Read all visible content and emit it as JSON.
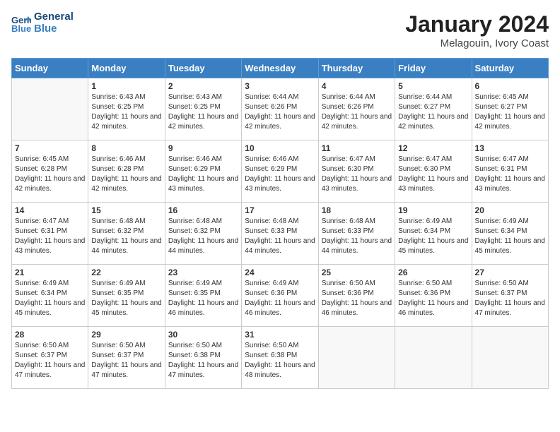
{
  "header": {
    "logo_line1": "General",
    "logo_line2": "Blue",
    "title": "January 2024",
    "subtitle": "Melagouin, Ivory Coast"
  },
  "columns": [
    "Sunday",
    "Monday",
    "Tuesday",
    "Wednesday",
    "Thursday",
    "Friday",
    "Saturday"
  ],
  "weeks": [
    [
      {
        "num": "",
        "sunrise": "",
        "sunset": "",
        "daylight": ""
      },
      {
        "num": "1",
        "sunrise": "Sunrise: 6:43 AM",
        "sunset": "Sunset: 6:25 PM",
        "daylight": "Daylight: 11 hours and 42 minutes."
      },
      {
        "num": "2",
        "sunrise": "Sunrise: 6:43 AM",
        "sunset": "Sunset: 6:25 PM",
        "daylight": "Daylight: 11 hours and 42 minutes."
      },
      {
        "num": "3",
        "sunrise": "Sunrise: 6:44 AM",
        "sunset": "Sunset: 6:26 PM",
        "daylight": "Daylight: 11 hours and 42 minutes."
      },
      {
        "num": "4",
        "sunrise": "Sunrise: 6:44 AM",
        "sunset": "Sunset: 6:26 PM",
        "daylight": "Daylight: 11 hours and 42 minutes."
      },
      {
        "num": "5",
        "sunrise": "Sunrise: 6:44 AM",
        "sunset": "Sunset: 6:27 PM",
        "daylight": "Daylight: 11 hours and 42 minutes."
      },
      {
        "num": "6",
        "sunrise": "Sunrise: 6:45 AM",
        "sunset": "Sunset: 6:27 PM",
        "daylight": "Daylight: 11 hours and 42 minutes."
      }
    ],
    [
      {
        "num": "7",
        "sunrise": "Sunrise: 6:45 AM",
        "sunset": "Sunset: 6:28 PM",
        "daylight": "Daylight: 11 hours and 42 minutes."
      },
      {
        "num": "8",
        "sunrise": "Sunrise: 6:46 AM",
        "sunset": "Sunset: 6:28 PM",
        "daylight": "Daylight: 11 hours and 42 minutes."
      },
      {
        "num": "9",
        "sunrise": "Sunrise: 6:46 AM",
        "sunset": "Sunset: 6:29 PM",
        "daylight": "Daylight: 11 hours and 43 minutes."
      },
      {
        "num": "10",
        "sunrise": "Sunrise: 6:46 AM",
        "sunset": "Sunset: 6:29 PM",
        "daylight": "Daylight: 11 hours and 43 minutes."
      },
      {
        "num": "11",
        "sunrise": "Sunrise: 6:47 AM",
        "sunset": "Sunset: 6:30 PM",
        "daylight": "Daylight: 11 hours and 43 minutes."
      },
      {
        "num": "12",
        "sunrise": "Sunrise: 6:47 AM",
        "sunset": "Sunset: 6:30 PM",
        "daylight": "Daylight: 11 hours and 43 minutes."
      },
      {
        "num": "13",
        "sunrise": "Sunrise: 6:47 AM",
        "sunset": "Sunset: 6:31 PM",
        "daylight": "Daylight: 11 hours and 43 minutes."
      }
    ],
    [
      {
        "num": "14",
        "sunrise": "Sunrise: 6:47 AM",
        "sunset": "Sunset: 6:31 PM",
        "daylight": "Daylight: 11 hours and 43 minutes."
      },
      {
        "num": "15",
        "sunrise": "Sunrise: 6:48 AM",
        "sunset": "Sunset: 6:32 PM",
        "daylight": "Daylight: 11 hours and 44 minutes."
      },
      {
        "num": "16",
        "sunrise": "Sunrise: 6:48 AM",
        "sunset": "Sunset: 6:32 PM",
        "daylight": "Daylight: 11 hours and 44 minutes."
      },
      {
        "num": "17",
        "sunrise": "Sunrise: 6:48 AM",
        "sunset": "Sunset: 6:33 PM",
        "daylight": "Daylight: 11 hours and 44 minutes."
      },
      {
        "num": "18",
        "sunrise": "Sunrise: 6:48 AM",
        "sunset": "Sunset: 6:33 PM",
        "daylight": "Daylight: 11 hours and 44 minutes."
      },
      {
        "num": "19",
        "sunrise": "Sunrise: 6:49 AM",
        "sunset": "Sunset: 6:34 PM",
        "daylight": "Daylight: 11 hours and 45 minutes."
      },
      {
        "num": "20",
        "sunrise": "Sunrise: 6:49 AM",
        "sunset": "Sunset: 6:34 PM",
        "daylight": "Daylight: 11 hours and 45 minutes."
      }
    ],
    [
      {
        "num": "21",
        "sunrise": "Sunrise: 6:49 AM",
        "sunset": "Sunset: 6:34 PM",
        "daylight": "Daylight: 11 hours and 45 minutes."
      },
      {
        "num": "22",
        "sunrise": "Sunrise: 6:49 AM",
        "sunset": "Sunset: 6:35 PM",
        "daylight": "Daylight: 11 hours and 45 minutes."
      },
      {
        "num": "23",
        "sunrise": "Sunrise: 6:49 AM",
        "sunset": "Sunset: 6:35 PM",
        "daylight": "Daylight: 11 hours and 46 minutes."
      },
      {
        "num": "24",
        "sunrise": "Sunrise: 6:49 AM",
        "sunset": "Sunset: 6:36 PM",
        "daylight": "Daylight: 11 hours and 46 minutes."
      },
      {
        "num": "25",
        "sunrise": "Sunrise: 6:50 AM",
        "sunset": "Sunset: 6:36 PM",
        "daylight": "Daylight: 11 hours and 46 minutes."
      },
      {
        "num": "26",
        "sunrise": "Sunrise: 6:50 AM",
        "sunset": "Sunset: 6:36 PM",
        "daylight": "Daylight: 11 hours and 46 minutes."
      },
      {
        "num": "27",
        "sunrise": "Sunrise: 6:50 AM",
        "sunset": "Sunset: 6:37 PM",
        "daylight": "Daylight: 11 hours and 47 minutes."
      }
    ],
    [
      {
        "num": "28",
        "sunrise": "Sunrise: 6:50 AM",
        "sunset": "Sunset: 6:37 PM",
        "daylight": "Daylight: 11 hours and 47 minutes."
      },
      {
        "num": "29",
        "sunrise": "Sunrise: 6:50 AM",
        "sunset": "Sunset: 6:37 PM",
        "daylight": "Daylight: 11 hours and 47 minutes."
      },
      {
        "num": "30",
        "sunrise": "Sunrise: 6:50 AM",
        "sunset": "Sunset: 6:38 PM",
        "daylight": "Daylight: 11 hours and 47 minutes."
      },
      {
        "num": "31",
        "sunrise": "Sunrise: 6:50 AM",
        "sunset": "Sunset: 6:38 PM",
        "daylight": "Daylight: 11 hours and 48 minutes."
      },
      {
        "num": "",
        "sunrise": "",
        "sunset": "",
        "daylight": ""
      },
      {
        "num": "",
        "sunrise": "",
        "sunset": "",
        "daylight": ""
      },
      {
        "num": "",
        "sunrise": "",
        "sunset": "",
        "daylight": ""
      }
    ]
  ]
}
